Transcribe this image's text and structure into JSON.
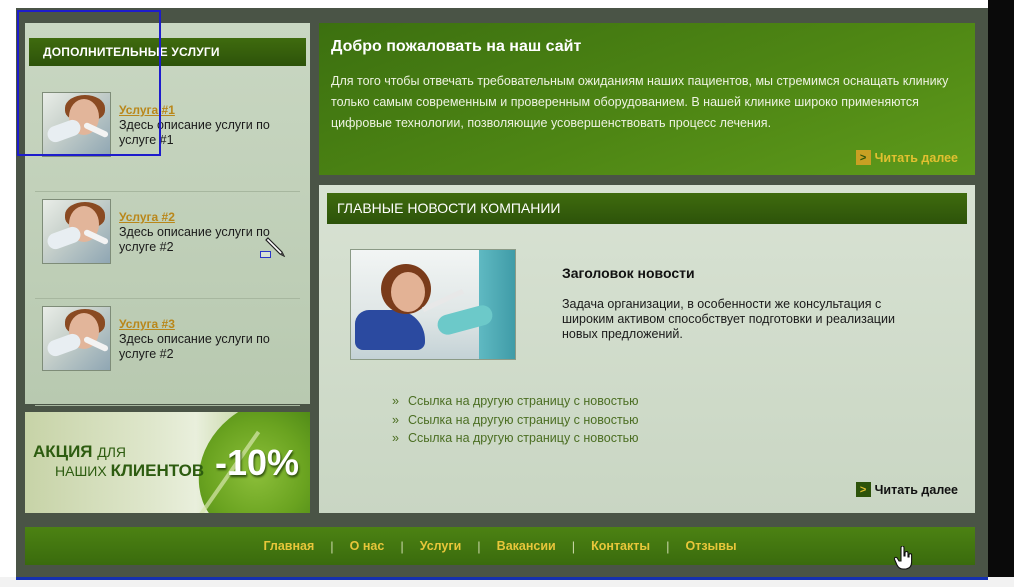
{
  "sidebar": {
    "header": "ДОПОЛНИТЕЛЬНЫЕ УСЛУГИ",
    "items": [
      {
        "title": "Услуга #1",
        "description": "Здесь описание услуги по услуге #1"
      },
      {
        "title": "Услуга #2",
        "description": "Здесь описание услуги по услуге #2"
      },
      {
        "title": "Услуга #3",
        "description": "Здесь описание услуги по услуге #2"
      }
    ]
  },
  "promo": {
    "word1": "АКЦИЯ",
    "word2": "ДЛЯ",
    "word3": "НАШИХ",
    "word4": "КЛИЕНТОВ",
    "discount": "-10%"
  },
  "welcome": {
    "title": "Добро пожаловать на наш сайт",
    "text": "Для того чтобы отвечать требовательным ожиданиям наших пациентов, мы стремимся оснащать клинику только самым современным и проверенным оборудованием. В нашей клинике широко применяются цифровые технологии, позволяющие усовершенствовать процесс лечения.",
    "more_label": "Читать далее"
  },
  "news": {
    "header": "ГЛАВНЫЕ НОВОСТИ КОМПАНИИ",
    "title": "Заголовок новости",
    "text": "Задача организации, в особенности же консультация с широким активом способствует подготовки и реализации новых предложений.",
    "links": [
      "Ссылка на другую страницу с новостью",
      "Ссылка на другую страницу с новостью",
      "Ссылка на другую страницу с новостью"
    ],
    "more_label": "Читать далее"
  },
  "footer": {
    "nav": [
      "Главная",
      "О нас",
      "Услуги",
      "Вакансии",
      "Контакты",
      "Отзывы"
    ]
  },
  "colors": {
    "accent_gold": "#e8c63a",
    "brand_green": "#3f6b0e",
    "link_green": "#4b6e22"
  },
  "icons": {
    "arrow": ">",
    "bullet": "»"
  }
}
